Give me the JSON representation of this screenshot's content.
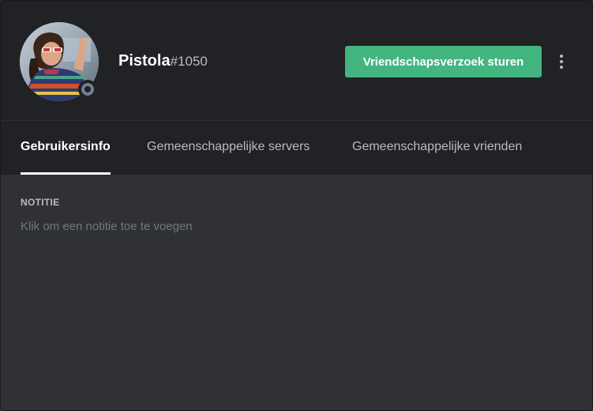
{
  "profile": {
    "username": "Pistola",
    "discriminator": "#1050",
    "status": "offline",
    "status_color": "#747f8d",
    "avatar_icon": "user-avatar"
  },
  "actions": {
    "friend_request_label": "Vriendschapsverzoek sturen",
    "friend_request_color": "#43b581",
    "more_icon": "vertical-ellipsis-icon"
  },
  "tabs": [
    {
      "label": "Gebruikersinfo",
      "active": true
    },
    {
      "label": "Gemeenschappelijke servers",
      "active": false
    },
    {
      "label": "Gemeenschappelijke vrienden",
      "active": false
    }
  ],
  "note": {
    "heading": "NOTITIE",
    "placeholder": "Klik om een notitie toe te voegen",
    "value": ""
  }
}
